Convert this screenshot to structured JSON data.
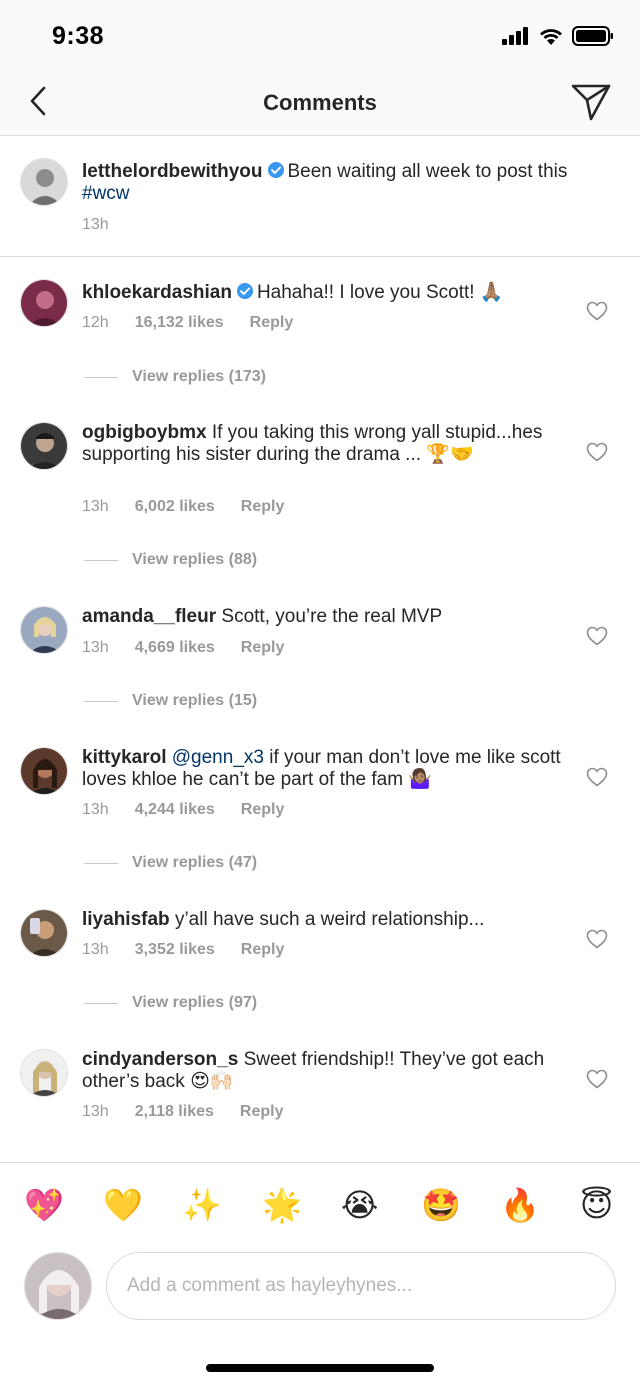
{
  "status_bar": {
    "time": "9:38"
  },
  "nav": {
    "title": "Comments"
  },
  "caption": {
    "username": "letthelordbewithyou",
    "verified": true,
    "text_before_tag": "Been waiting all week to post this ",
    "hashtag": "#wcw",
    "time": "13h"
  },
  "comments": [
    {
      "username": "khloekardashian",
      "verified": true,
      "text": "Hahaha!! I love you Scott! 🙏🏽",
      "time": "12h",
      "likes": "16,132 likes",
      "reply": "Reply",
      "view_replies": "View replies (173)",
      "avatar_color": "#7a2b4a"
    },
    {
      "username": "ogbigboybmx",
      "verified": false,
      "text": "If you taking this wrong yall stupid...hes supporting his sister during the drama ... 🏆🤝",
      "time": "13h",
      "likes": "6,002 likes",
      "reply": "Reply",
      "view_replies": "View replies (88)",
      "avatar_color": "#3a3a3a"
    },
    {
      "username": "amanda__fleur",
      "verified": false,
      "text": "Scott, you’re the real MVP",
      "time": "13h",
      "likes": "4,669 likes",
      "reply": "Reply",
      "view_replies": "View replies (15)",
      "avatar_color": "#9aa9bf"
    },
    {
      "username": "kittykarol",
      "verified": false,
      "mention": "@genn_x3",
      "text": "if your man don’t love me like scott loves khloe he can’t be part of the fam 🤷🏽‍♀️",
      "time": "13h",
      "likes": "4,244 likes",
      "reply": "Reply",
      "view_replies": "View replies (47)",
      "avatar_color": "#5b3a2c"
    },
    {
      "username": "liyahisfab",
      "verified": false,
      "text": "y’all have such a weird relationship...",
      "time": "13h",
      "likes": "3,352 likes",
      "reply": "Reply",
      "view_replies": "View replies (97)",
      "avatar_color": "#6b5a48"
    },
    {
      "username": "cindyanderson_s",
      "verified": false,
      "text": "Sweet friendship!! They’ve got each other’s back 😍🙌🏻",
      "time": "13h",
      "likes": "2,118 likes",
      "reply": "Reply",
      "avatar_color": "#8a8478"
    }
  ],
  "emoji_bar": [
    "💖",
    "💛",
    "✨",
    "🌟",
    "😭",
    "🤩",
    "🔥",
    "😇"
  ],
  "composer": {
    "placeholder": "Add a comment as hayleyhynes..."
  },
  "colors": {
    "link": "#003569",
    "meta": "#999999",
    "divider": "#dbdbdb",
    "verified": "#3897f0"
  }
}
